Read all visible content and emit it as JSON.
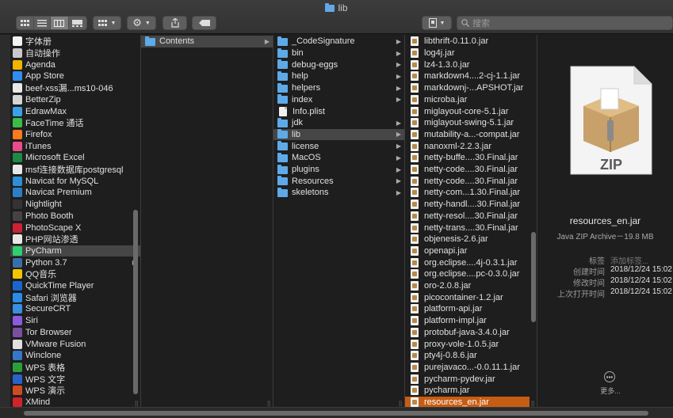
{
  "window": {
    "title": "lib"
  },
  "toolbar": {
    "view_modes": [
      "icon-view",
      "list-view",
      "column-view",
      "gallery-view"
    ],
    "arrange_icon": "grid-icon",
    "action_icon": "gear-icon",
    "share_icon": "share-icon",
    "tag_icon": "tag-icon",
    "path_icon": "path-icon",
    "search_placeholder": "搜索"
  },
  "col1": {
    "items": [
      {
        "label": "字体册"
      },
      {
        "label": "自动操作"
      },
      {
        "label": "Agenda"
      },
      {
        "label": "App Store"
      },
      {
        "label": "beef-xss漏...ms10-046"
      },
      {
        "label": "BetterZip"
      },
      {
        "label": "EdrawMax"
      },
      {
        "label": "FaceTime 通话"
      },
      {
        "label": "Firefox"
      },
      {
        "label": "iTunes"
      },
      {
        "label": "Microsoft Excel"
      },
      {
        "label": "msf连接数据库postgresql"
      },
      {
        "label": "Navicat for MySQL"
      },
      {
        "label": "Navicat Premium"
      },
      {
        "label": "Nightlight"
      },
      {
        "label": "Photo Booth"
      },
      {
        "label": "PhotoScape X"
      },
      {
        "label": "PHP网站渗透"
      },
      {
        "label": "PyCharm"
      },
      {
        "label": "Python 3.7"
      },
      {
        "label": "QQ音乐"
      },
      {
        "label": "QuickTime Player"
      },
      {
        "label": "Safari 浏览器"
      },
      {
        "label": "SecureCRT"
      },
      {
        "label": "Siri"
      },
      {
        "label": "Tor Browser"
      },
      {
        "label": "VMware Fusion"
      },
      {
        "label": "Winclone"
      },
      {
        "label": "WPS 表格"
      },
      {
        "label": "WPS 文字"
      },
      {
        "label": "WPS 演示"
      },
      {
        "label": "XMind"
      }
    ]
  },
  "col2": {
    "items": [
      {
        "label": "Contents"
      }
    ]
  },
  "col3": {
    "items": [
      {
        "label": "_CodeSignature"
      },
      {
        "label": "bin"
      },
      {
        "label": "debug-eggs"
      },
      {
        "label": "help"
      },
      {
        "label": "helpers"
      },
      {
        "label": "index"
      },
      {
        "label": "Info.plist"
      },
      {
        "label": "jdk"
      },
      {
        "label": "lib"
      },
      {
        "label": "license"
      },
      {
        "label": "MacOS"
      },
      {
        "label": "plugins"
      },
      {
        "label": "Resources"
      },
      {
        "label": "skeletons"
      }
    ]
  },
  "col4": {
    "items": [
      {
        "label": "libthrift-0.11.0.jar"
      },
      {
        "label": "log4j.jar"
      },
      {
        "label": "lz4-1.3.0.jar"
      },
      {
        "label": "markdown4....2-cj-1.1.jar"
      },
      {
        "label": "markdownj-...APSHOT.jar"
      },
      {
        "label": "microba.jar"
      },
      {
        "label": "miglayout-core-5.1.jar"
      },
      {
        "label": "miglayout-swing-5.1.jar"
      },
      {
        "label": "mutability-a...-compat.jar"
      },
      {
        "label": "nanoxml-2.2.3.jar"
      },
      {
        "label": "netty-buffe....30.Final.jar"
      },
      {
        "label": "netty-code....30.Final.jar"
      },
      {
        "label": "netty-code....30.Final.jar"
      },
      {
        "label": "netty-com...1.30.Final.jar"
      },
      {
        "label": "netty-handl....30.Final.jar"
      },
      {
        "label": "netty-resol....30.Final.jar"
      },
      {
        "label": "netty-trans....30.Final.jar"
      },
      {
        "label": "objenesis-2.6.jar"
      },
      {
        "label": "openapi.jar"
      },
      {
        "label": "org.eclipse....4j-0.3.1.jar"
      },
      {
        "label": "org.eclipse....pc-0.3.0.jar"
      },
      {
        "label": "oro-2.0.8.jar"
      },
      {
        "label": "picocontainer-1.2.jar"
      },
      {
        "label": "platform-api.jar"
      },
      {
        "label": "platform-impl.jar"
      },
      {
        "label": "protobuf-java-3.4.0.jar"
      },
      {
        "label": "proxy-vole-1.0.5.jar"
      },
      {
        "label": "pty4j-0.8.6.jar"
      },
      {
        "label": "purejavaco...-0.0.11.1.jar"
      },
      {
        "label": "pycharm-pydev.jar"
      },
      {
        "label": "pycharm.jar"
      },
      {
        "label": "resources_en.jar"
      }
    ]
  },
  "preview": {
    "icon_label": "ZIP",
    "name": "resources_en.jar",
    "kind": "Java ZIP Archive－19.8 MB",
    "tags_label": "标签",
    "tags_placeholder": "添加标签...",
    "created_label": "创建时间",
    "created_value": "2018/12/24 15:02",
    "modified_label": "修改时间",
    "modified_value": "2018/12/24 15:02",
    "opened_label": "上次打开时间",
    "opened_value": "2018/12/24 15:02",
    "more_label": "更多..."
  },
  "colors": {
    "selection": "#c65d14",
    "folder": "#5eaae8"
  }
}
